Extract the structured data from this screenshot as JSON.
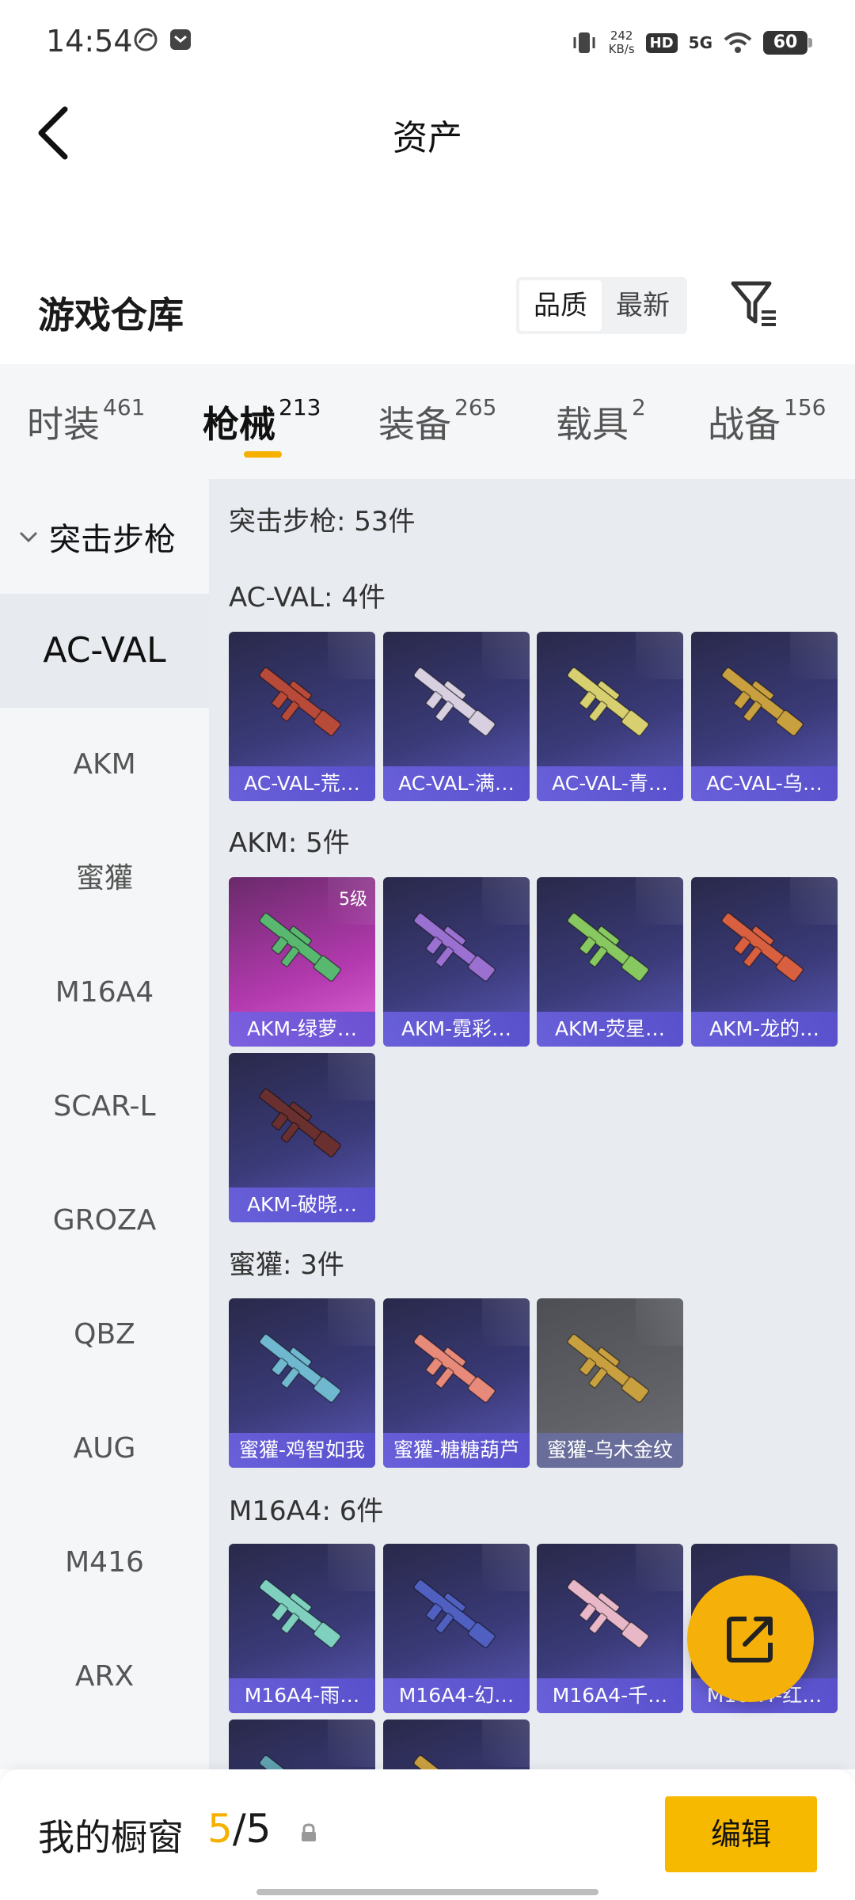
{
  "status_bar": {
    "time": "14:54",
    "net_speed_value": "242",
    "net_speed_unit": "KB/s",
    "hd": "HD",
    "network": "5G",
    "battery": "60"
  },
  "header": {
    "title": "资产"
  },
  "warehouse": {
    "title": "游戏仓库",
    "sort_options": [
      "品质",
      "最新"
    ],
    "sort_active": "品质"
  },
  "tabs": [
    {
      "label": "时装",
      "count": "461"
    },
    {
      "label": "枪械",
      "count": "213"
    },
    {
      "label": "装备",
      "count": "265"
    },
    {
      "label": "载具",
      "count": "2"
    },
    {
      "label": "战备",
      "count": "156"
    }
  ],
  "active_tab": "枪械",
  "sidebar": {
    "category": "突击步枪",
    "items": [
      "AC-VAL",
      "AKM",
      "蜜獾",
      "M16A4",
      "SCAR-L",
      "GROZA",
      "QBZ",
      "AUG",
      "M416",
      "ARX"
    ],
    "active": "AC-VAL"
  },
  "content": {
    "summary": "突击步枪: 53件",
    "sections": [
      {
        "title": "AC-VAL: 4件",
        "cards": [
          {
            "label": "AC-VAL-荒…",
            "color": "#b84a3a"
          },
          {
            "label": "AC-VAL-满…",
            "color": "#d8d0e0"
          },
          {
            "label": "AC-VAL-青…",
            "color": "#d8d070"
          },
          {
            "label": "AC-VAL-乌…",
            "color": "#c8a040"
          }
        ]
      },
      {
        "title": "AKM: 5件",
        "cards": [
          {
            "label": "AKM-绿萝…",
            "color": "#58b870",
            "level": "5级"
          },
          {
            "label": "AKM-霓彩…",
            "color": "#9a70d0"
          },
          {
            "label": "AKM-荧星…",
            "color": "#88c860"
          },
          {
            "label": "AKM-龙的…",
            "color": "#d86040"
          },
          {
            "label": "AKM-破晓…",
            "color": "#6a3030"
          }
        ]
      },
      {
        "title": "蜜獾: 3件",
        "cards": [
          {
            "label": "蜜獾-鸡智如我",
            "color": "#70b8d0"
          },
          {
            "label": "蜜獾-糖糖葫芦",
            "color": "#e88a7a"
          },
          {
            "label": "蜜獾-乌木金纹",
            "color": "#c8a040"
          }
        ]
      },
      {
        "title": "M16A4: 6件",
        "cards": [
          {
            "label": "M16A4-雨…",
            "color": "#80d0c0"
          },
          {
            "label": "M16A4-幻…",
            "color": "#5060c0"
          },
          {
            "label": "M16A4-千…",
            "color": "#e8b8c8"
          },
          {
            "label": "M16A4-红…",
            "color": "#c04040"
          },
          {
            "label": "",
            "color": "#60a0b0"
          },
          {
            "label": "",
            "color": "#c8a040"
          }
        ]
      }
    ]
  },
  "bottom_bar": {
    "title": "我的橱窗",
    "current": "5",
    "separator": "/",
    "total": "5",
    "edit_label": "编辑"
  },
  "colors": {
    "accent": "#f5b000",
    "card_purple": "#3a3a78",
    "card_pink": "#b43ab0",
    "card_gray": "#5f6166"
  },
  "icons": [
    "back-arrow-icon",
    "filter-icon",
    "chevron-down-icon",
    "share-icon",
    "lock-icon"
  ]
}
